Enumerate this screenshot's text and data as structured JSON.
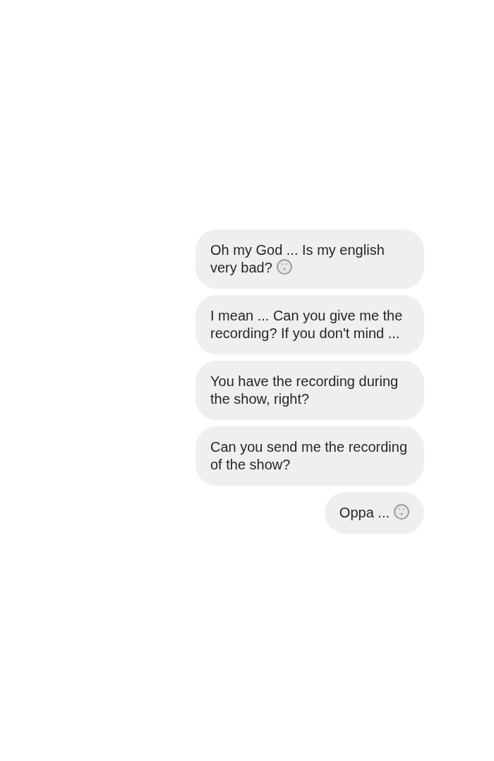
{
  "messages": [
    {
      "text": "Oh my God ... Is my english very bad?",
      "trailing_emoji": true
    },
    {
      "text": "I mean ... Can you give me the recording? If you don't mind ...",
      "trailing_emoji": false
    },
    {
      "text": "You have the recording during the show, right?",
      "trailing_emoji": false
    },
    {
      "text": "Can you send me the recording of the show?",
      "trailing_emoji": false
    },
    {
      "text": "Oppa ...",
      "trailing_emoji": true
    }
  ]
}
